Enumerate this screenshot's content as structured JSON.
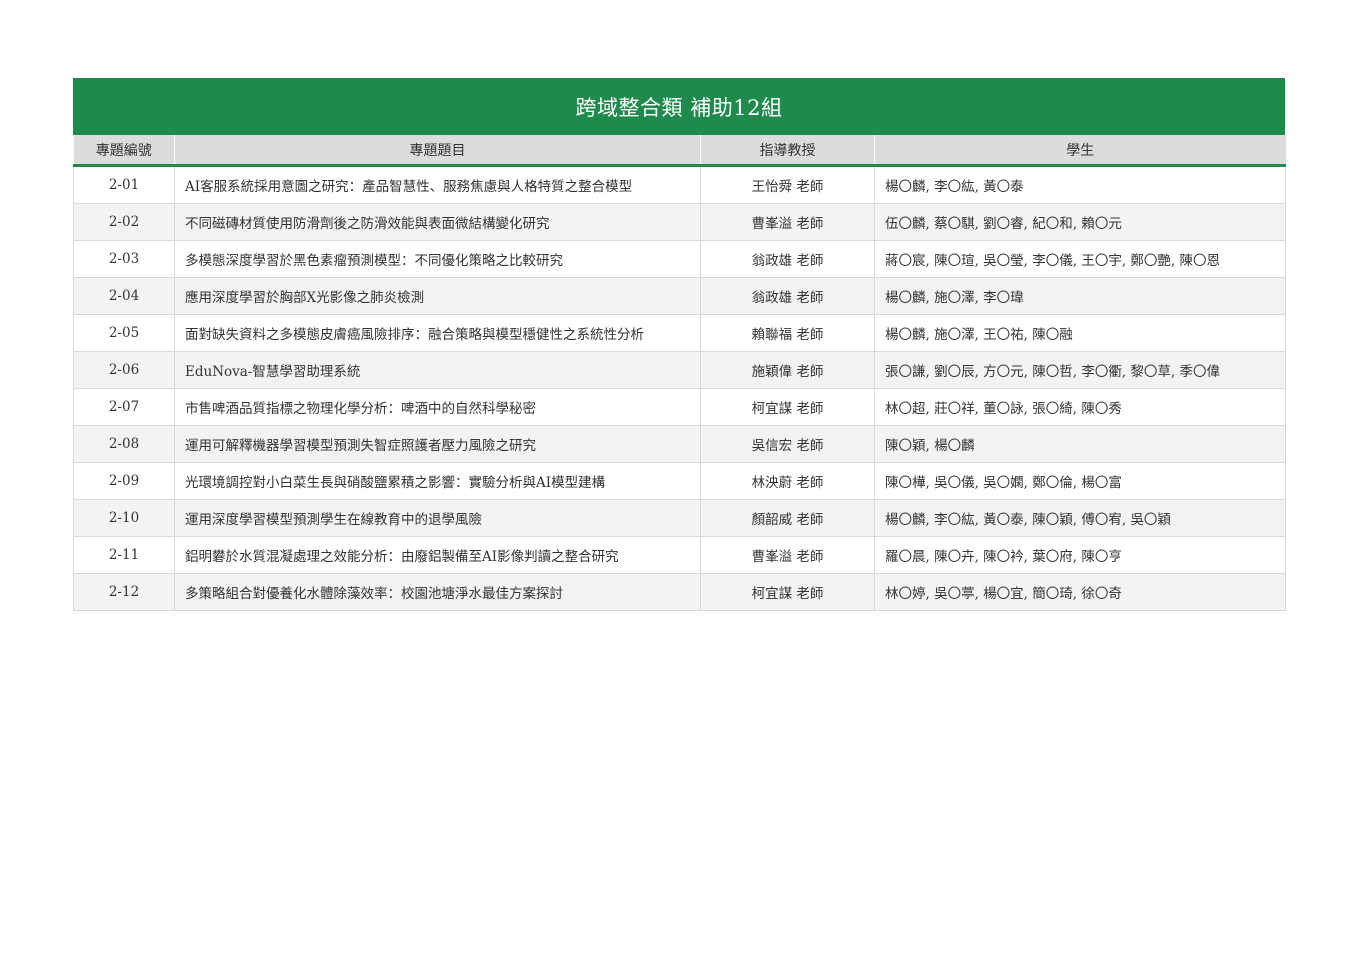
{
  "banner": {
    "title": "跨域整合類 補助12組"
  },
  "headers": {
    "id": "專題編號",
    "title": "專題題目",
    "advisor": "指導教授",
    "students": "學生"
  },
  "rows": [
    {
      "id": "2-01",
      "title": "AI客服系統採用意圖之研究：產品智慧性、服務焦慮與人格特質之整合模型",
      "advisor": "王怡舜 老師",
      "students": "楊〇麟, 李〇紘, 黃〇泰"
    },
    {
      "id": "2-02",
      "title": "不同磁磚材質使用防滑劑後之防滑效能與表面微結構變化研究",
      "advisor": "曹峯溢 老師",
      "students": "伍〇麟, 蔡〇騏, 劉〇睿, 紀〇和, 賴〇元"
    },
    {
      "id": "2-03",
      "title": "多模態深度學習於黑色素瘤預測模型：不同優化策略之比較研究",
      "advisor": "翁政雄 老師",
      "students": "蔣〇宸, 陳〇瑄, 吳〇瑩, 李〇儀, 王〇宇, 鄭〇艷, 陳〇恩"
    },
    {
      "id": "2-04",
      "title": "應用深度學習於胸部X光影像之肺炎檢測",
      "advisor": "翁政雄 老師",
      "students": "楊〇麟, 施〇澤, 李〇瑋"
    },
    {
      "id": "2-05",
      "title": "面對缺失資料之多模態皮膚癌風險排序：融合策略與模型穩健性之系統性分析",
      "advisor": "賴聯福 老師",
      "students": "楊〇麟, 施〇澤, 王〇祐, 陳〇融"
    },
    {
      "id": "2-06",
      "title": "EduNova-智慧學習助理系統",
      "advisor": "施穎偉 老師",
      "students": "張〇謙, 劉〇辰, 方〇元, 陳〇哲, 李〇衢, 黎〇草, 季〇偉"
    },
    {
      "id": "2-07",
      "title": "市售啤酒品質指標之物理化學分析：啤酒中的自然科學秘密",
      "advisor": "柯宜謀 老師",
      "students": "林〇超, 莊〇祥, 董〇詠, 張〇綺, 陳〇秀"
    },
    {
      "id": "2-08",
      "title": "運用可解釋機器學習模型預測失智症照護者壓力風險之研究",
      "advisor": "吳信宏 老師",
      "students": "陳〇穎, 楊〇麟"
    },
    {
      "id": "2-09",
      "title": "光環境調控對小白菜生長與硝酸鹽累積之影響：實驗分析與AI模型建構",
      "advisor": "林泱蔚 老師",
      "students": "陳〇樺, 吳〇儀, 吳〇嫻, 鄭〇倫, 楊〇富"
    },
    {
      "id": "2-10",
      "title": "運用深度學習模型預測學生在線教育中的退學風險",
      "advisor": "顏韶威 老師",
      "students": "楊〇麟, 李〇紘, 黃〇泰, 陳〇穎, 傅〇宥, 吳〇穎"
    },
    {
      "id": "2-11",
      "title": "鋁明礬於水質混凝處理之效能分析：由廢鋁製備至AI影像判讀之整合研究",
      "advisor": "曹峯溢 老師",
      "students": "羅〇晨, 陳〇卉, 陳〇衿, 葉〇府, 陳〇亨"
    },
    {
      "id": "2-12",
      "title": "多策略組合對優養化水體除藻效率：校園池塘淨水最佳方案探討",
      "advisor": "柯宜謀 老師",
      "students": "林〇婷, 吳〇葶, 楊〇宜, 簡〇琦, 徐〇奇"
    }
  ]
}
